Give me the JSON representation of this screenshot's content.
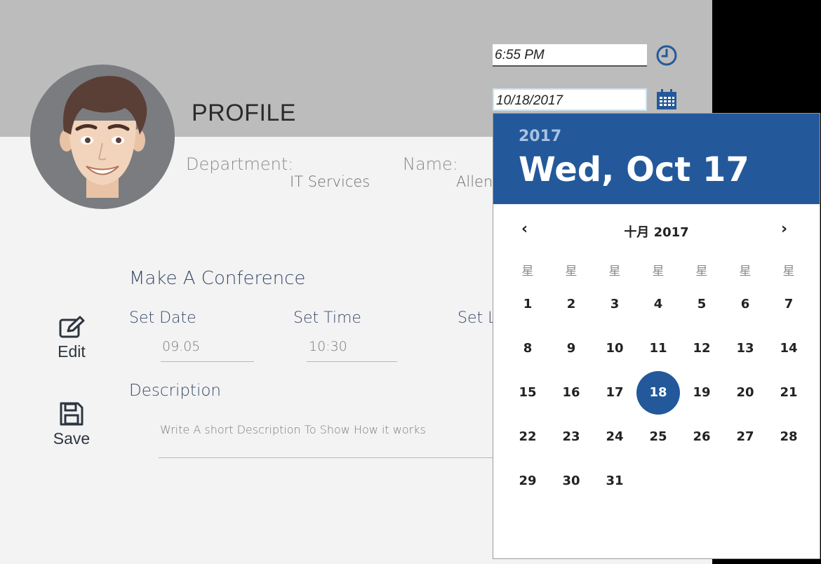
{
  "header": {
    "title": "PROFILE",
    "time_value": "6:55 PM",
    "date_value": "10/18/2017"
  },
  "profile": {
    "department_label": "Department:",
    "department_value": "IT Services",
    "name_label": "Name:",
    "name_value": "Allen"
  },
  "conference": {
    "title": "Make A Conference",
    "set_date_label": "Set Date",
    "set_date_value": "09.05",
    "set_time_label": "Set Time",
    "set_time_value": "10:30",
    "set_location_label": "Set Lo",
    "description_label": "Description",
    "description_placeholder": "Write A short Description To Show How it works"
  },
  "actions": {
    "edit_label": "Edit",
    "save_label": "Save"
  },
  "calendar": {
    "year": "2017",
    "selected_long": "Wed, Oct 17",
    "month_label": "十月 2017",
    "prev_icon": "‹",
    "next_icon": "›",
    "weekdays": [
      "星",
      "星",
      "星",
      "星",
      "星",
      "星",
      "星"
    ],
    "days": [
      "1",
      "2",
      "3",
      "4",
      "5",
      "6",
      "7",
      "8",
      "9",
      "10",
      "11",
      "12",
      "13",
      "14",
      "15",
      "16",
      "17",
      "18",
      "19",
      "20",
      "21",
      "22",
      "23",
      "24",
      "25",
      "26",
      "27",
      "28",
      "29",
      "30",
      "31"
    ],
    "selected_day": "18",
    "accent_color": "#23599b"
  },
  "icons": {
    "time": "clock-icon",
    "date": "calendar-icon",
    "edit": "edit-icon",
    "save": "save-icon"
  }
}
